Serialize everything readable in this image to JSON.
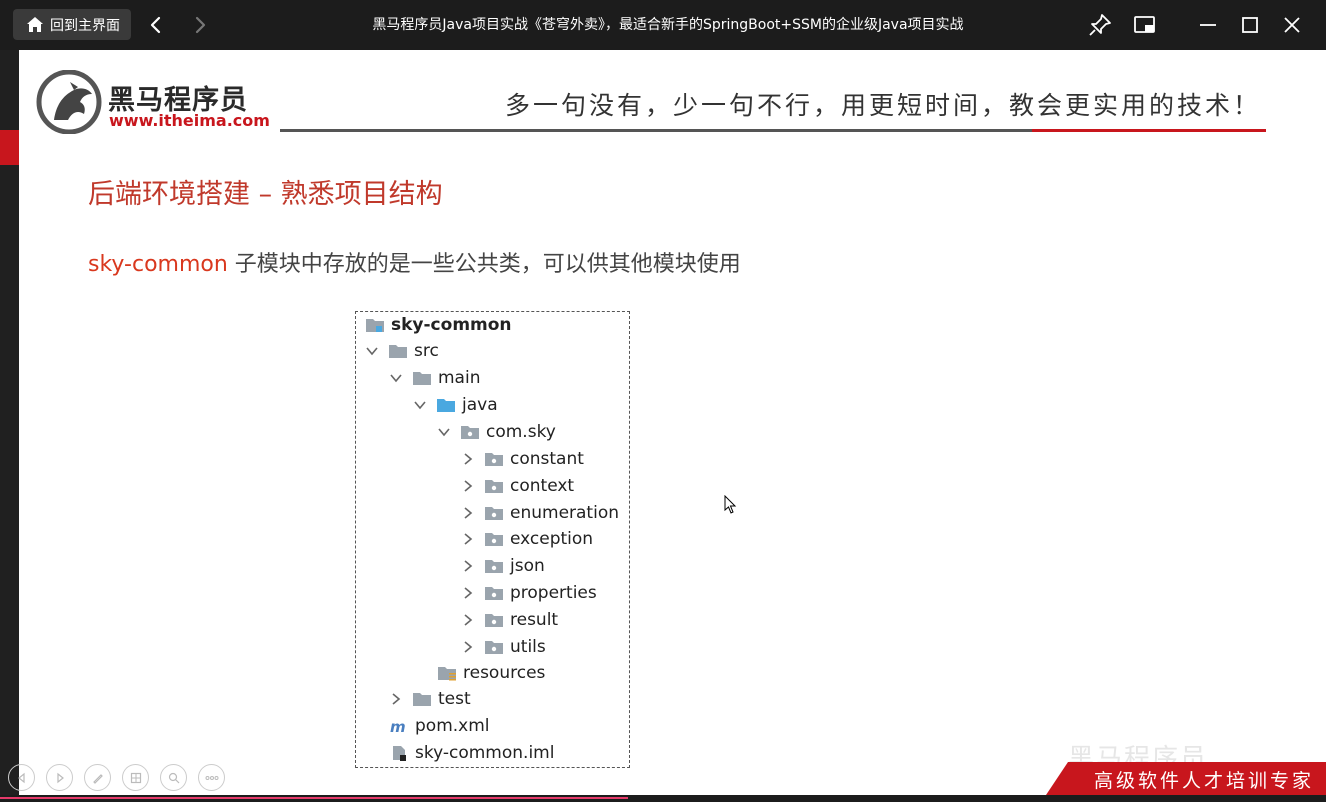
{
  "titlebar": {
    "home_label": "回到主界面",
    "title": "黑马程序员Java项目实战《苍穹外卖》，最适合新手的SpringBoot+SSM的企业级Java项目实战"
  },
  "slide": {
    "brand_cn": "黑马程序员",
    "brand_url": "www.itheima.com",
    "slogan": "多一句没有，少一句不行，用更短时间，教会更实用的技术！",
    "heading": "后端环境搭建 – 熟悉项目结构",
    "desc_highlight": "sky-common",
    "desc_rest": " 子模块中存放的是一些公共类，可以供其他模块使用",
    "tree": {
      "root": "sky-common",
      "src": "src",
      "main": "main",
      "java": "java",
      "package": "com.sky",
      "subpackages": [
        "constant",
        "context",
        "enumeration",
        "exception",
        "json",
        "properties",
        "result",
        "utils"
      ],
      "resources": "resources",
      "test": "test",
      "pom": "pom.xml",
      "iml": "sky-common.iml"
    },
    "watermark": "黑马程序员",
    "banner": "高级软件人才培训专家"
  },
  "colors": {
    "accent_red": "#c8161d",
    "heading_red": "#c0392b",
    "folder_grey": "#9aa4ad",
    "folder_blue": "#4aa8e0",
    "progress_pink": "#e53a6a"
  },
  "icons": [
    "home-icon",
    "back-arrow-icon",
    "forward-arrow-icon",
    "pin-icon",
    "picture-in-picture-icon",
    "minimize-icon",
    "maximize-icon",
    "close-icon",
    "folder-icon",
    "chevron-right-icon",
    "chevron-down-icon",
    "maven-icon",
    "file-icon",
    "cursor-icon"
  ]
}
